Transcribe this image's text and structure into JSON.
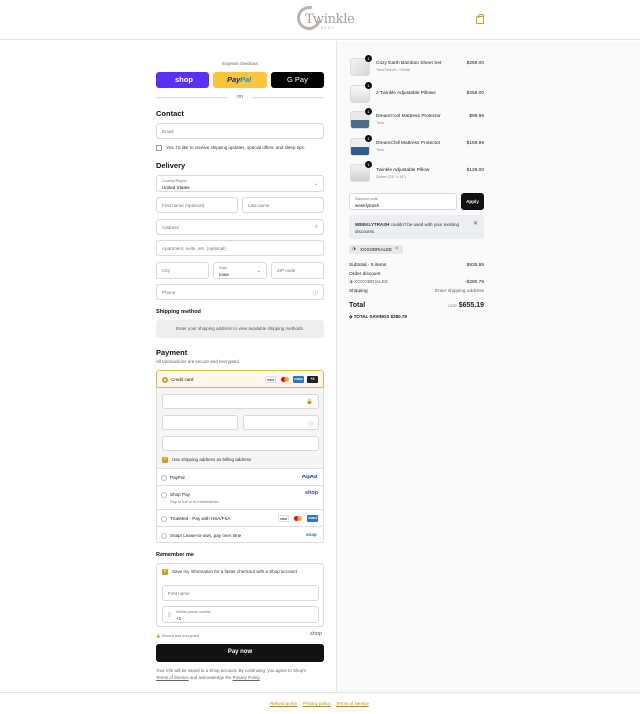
{
  "brand": {
    "name": "Twinkle",
    "sub": "BEDS"
  },
  "express": {
    "title": "Express checkout",
    "shop": "shop",
    "paypal_a": "Pay",
    "paypal_b": "Pal",
    "gpay": "G Pay",
    "or": "OR"
  },
  "contact": {
    "title": "Contact",
    "email_placeholder": "Email",
    "news_label": "Yes, I'd like to receive shipping updates, special offers, and sleep tips."
  },
  "delivery": {
    "title": "Delivery",
    "country_label": "Country/Region",
    "country_value": "United States",
    "first_name": "First name (optional)",
    "last_name": "Last name",
    "address": "Address",
    "apartment": "Apartment, suite, etc. (optional)",
    "city": "City",
    "state_label": "State",
    "state_value": "Iowa",
    "zip": "ZIP code",
    "phone": "Phone"
  },
  "shipping": {
    "title": "Shipping method",
    "note": "Enter your shipping address to view available shipping methods."
  },
  "payment": {
    "title": "Payment",
    "subtitle": "All transactions are secure and encrypted.",
    "credit_card": "Credit card",
    "more_cards": "+3",
    "billing_label": "Use shipping address as billing address",
    "paypal": "PayPal",
    "shoppay": "Shop Pay",
    "shoppay_sub": "Pay in full or in installments",
    "shop_logo": "shop",
    "truemed": "TrueMed - Pay with HSA/FSA",
    "snap": "Snap! Lease-to-own, pay over time",
    "snap_logo": "snap"
  },
  "cards": {
    "visa": "VISA",
    "amex": "AMEX"
  },
  "remember": {
    "title": "Remember me",
    "save_label": "Save my information for a faster checkout with a Shop account",
    "first_name": "First name",
    "mobile_label": "Mobile phone number",
    "mobile_value": "+1",
    "secure": "Secure and encrypted",
    "shop": "shop"
  },
  "pay_now": "Pay now",
  "legal": {
    "text": "Your info will be saved to a Shop account. By continuing, you agree to Shop's",
    "terms": "Terms of Service",
    "and": "and acknowledge the",
    "privacy": "Privacy Policy",
    "end": "."
  },
  "footer": {
    "refund": "Refund policy",
    "privacy": "Privacy policy",
    "terms": "Terms of service"
  },
  "items": [
    {
      "name": "Cozy Earth Bamboo Sheet Set",
      "variant": "Twin/TwinXL / White",
      "price": "$269.00",
      "qty": "1"
    },
    {
      "name": "2 Twinkle Adjustable Pillows",
      "variant": "",
      "price": "$258.00",
      "qty": "1"
    },
    {
      "name": "DreamCool Mattress Protector",
      "variant": "Twin",
      "price": "$99.99",
      "qty": "1"
    },
    {
      "name": "DreamChill Mattress Protector",
      "variant": "Twin",
      "price": "$159.99",
      "qty": "1"
    },
    {
      "name": "Twinkle Adjustable Pillow",
      "variant": "Queen (20\" x 16\")",
      "price": "$129.00",
      "qty": "1"
    }
  ],
  "discount": {
    "label": "Discount code",
    "value": "weeklytrash",
    "apply": "Apply",
    "error_code": "WEEKLYTRASH",
    "error_text": " couldn't be used with your existing discounts.",
    "tag": "XOXOBRIALEE"
  },
  "summary": {
    "subtotal_label": "Subtotal · 5 items",
    "subtotal": "$935.98",
    "order_discount": "Order discount",
    "code": "XOXOBRIALEE",
    "discount_value": "-$280.79",
    "shipping_label": "Shipping",
    "shipping_value": "Enter shipping address",
    "total_label": "Total",
    "currency": "USD",
    "total": "$655.19",
    "savings_label": "TOTAL SAVINGS",
    "savings": "$280.79"
  },
  "colors": {
    "accent": "#c9a227",
    "shop": "#5a31f4",
    "paypal": "#ffc439",
    "pay_now": "#111111"
  }
}
